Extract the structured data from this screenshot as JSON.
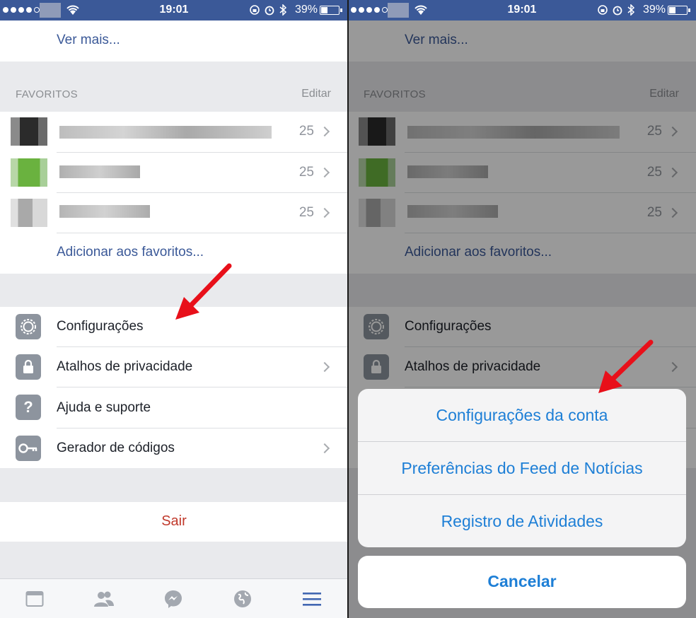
{
  "status_bar": {
    "time": "19:01",
    "battery": "39%"
  },
  "menu": {
    "see_more": "Ver mais...",
    "favorites_header": "FAVORITOS",
    "edit": "Editar",
    "favorites": [
      {
        "count": "25"
      },
      {
        "count": "25"
      },
      {
        "count": "25"
      }
    ],
    "add_favorites": "Adicionar aos favoritos...",
    "settings": [
      {
        "label": "Configurações"
      },
      {
        "label": "Atalhos de privacidade"
      },
      {
        "label": "Ajuda e suporte"
      },
      {
        "label": "Gerador de códigos"
      }
    ],
    "logout": "Sair"
  },
  "tabbar": {
    "tabs": [
      "newsfeed-icon",
      "friends-icon",
      "messenger-icon",
      "globe-icon",
      "menu-icon"
    ]
  },
  "action_sheet": {
    "options": [
      "Configurações da conta",
      "Preferências do Feed de Notícias",
      "Registro de Atividades"
    ],
    "cancel": "Cancelar"
  },
  "colors": {
    "brand": "#3b5998",
    "link": "#3b5998",
    "logout": "#c0392b",
    "sheet_action": "#1e7fd6",
    "annotation_arrow": "#e8101a"
  }
}
